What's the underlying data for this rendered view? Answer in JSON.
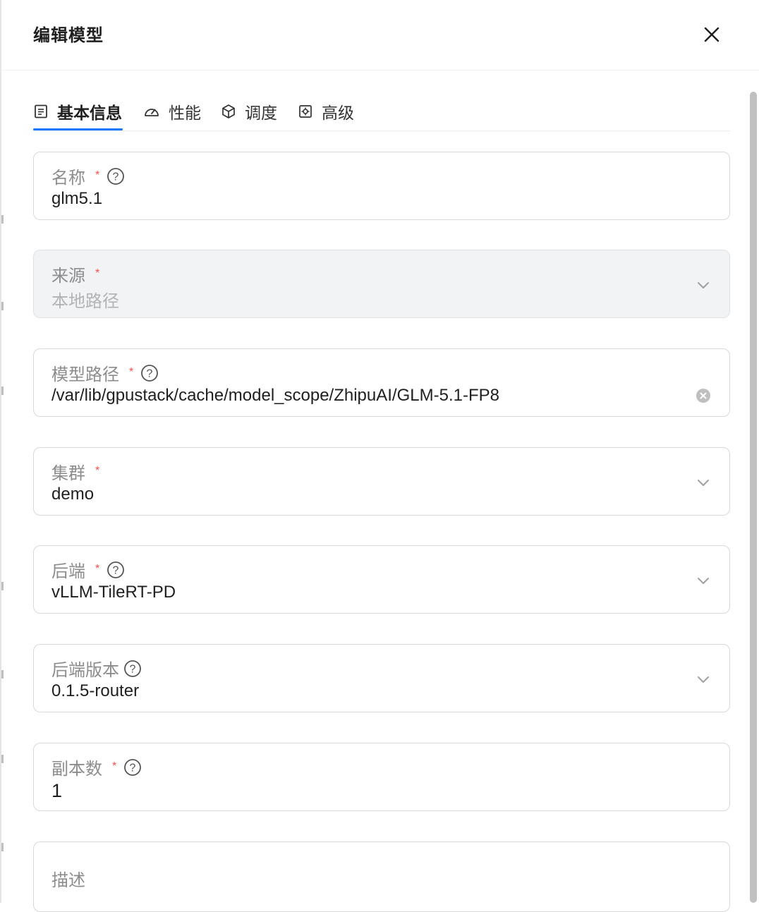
{
  "dialog": {
    "title": "编辑模型"
  },
  "tabs": [
    {
      "label": "基本信息",
      "icon": "form-list-icon",
      "active": true
    },
    {
      "label": "性能",
      "icon": "speedometer-icon",
      "active": false
    },
    {
      "label": "调度",
      "icon": "cube-icon",
      "active": false
    },
    {
      "label": "高级",
      "icon": "settings-gear-icon",
      "active": false
    }
  ],
  "fields": {
    "name": {
      "label": "名称",
      "required": true,
      "help": true,
      "value": "glm5.1"
    },
    "source": {
      "label": "来源",
      "required": true,
      "value": "本地路径",
      "disabled": true
    },
    "model_path": {
      "label": "模型路径",
      "required": true,
      "help": true,
      "value": "/var/lib/gpustack/cache/model_scope/ZhipuAI/GLM-5.1-FP8"
    },
    "cluster": {
      "label": "集群",
      "required": true,
      "value": "demo"
    },
    "backend": {
      "label": "后端",
      "required": true,
      "help": true,
      "value": "vLLM-TileRT-PD"
    },
    "backend_version": {
      "label": "后端版本",
      "required": false,
      "help": true,
      "value": "0.1.5-router"
    },
    "replicas": {
      "label": "副本数",
      "required": true,
      "help": true,
      "value": "1"
    },
    "description": {
      "label": "描述",
      "value": ""
    }
  },
  "colors": {
    "accent": "#1677ff",
    "required": "#ff4d4f",
    "disabled_bg": "#f2f3f5"
  },
  "required_mark": "*"
}
